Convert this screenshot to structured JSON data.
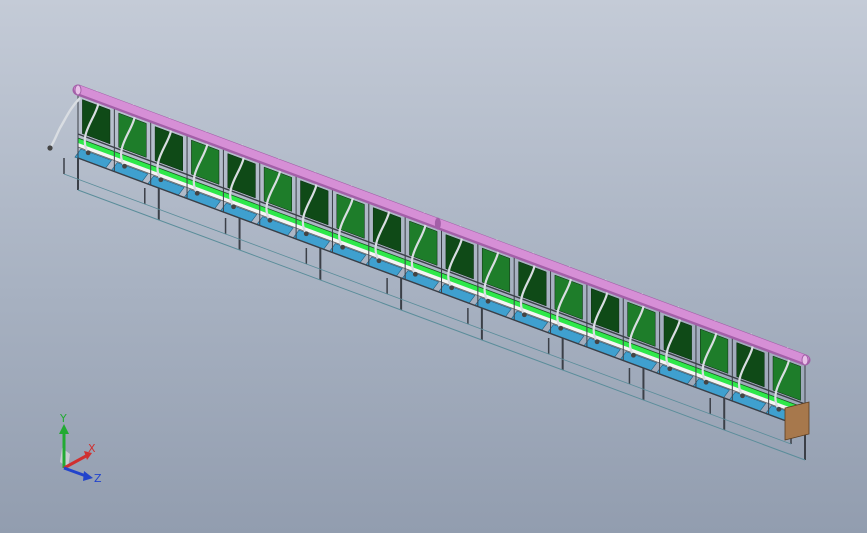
{
  "model": {
    "station_count": 20,
    "leg_count": 10,
    "colors": {
      "pipe": "#d68fd6",
      "pipe_dark": "#a35fa8",
      "panel": "#1e7d2a",
      "panel_dark": "#0f4a17",
      "belt_green": "#2ee84a",
      "belt_white": "#f4f4f4",
      "tray": "#3fa0cf",
      "frame": "#3b3f47",
      "hose": "#d9dde2",
      "cabinet": "#a7784c"
    }
  },
  "triad": {
    "x_label": "X",
    "y_label": "Y",
    "z_label": "Z",
    "colors": {
      "x": "#d03030",
      "y": "#22aa33",
      "z": "#2244cc"
    }
  }
}
